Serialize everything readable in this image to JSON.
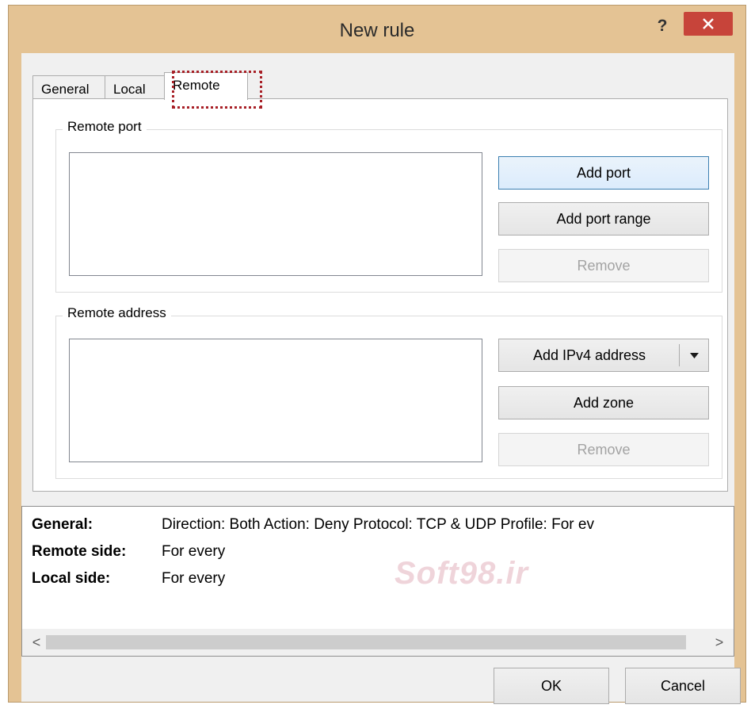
{
  "window": {
    "title": "New rule",
    "help_label": "?"
  },
  "tabs": [
    {
      "label": "General"
    },
    {
      "label": "Local"
    },
    {
      "label": "Remote"
    }
  ],
  "remote_port": {
    "group_label": "Remote port",
    "add_port": "Add port",
    "add_port_range": "Add port range",
    "remove": "Remove"
  },
  "remote_address": {
    "group_label": "Remote address",
    "add_ipv4": "Add IPv4 address",
    "add_zone": "Add zone",
    "remove": "Remove"
  },
  "summary": {
    "general_key": "General:",
    "general_val": "Direction: Both   Action: Deny   Protocol: TCP & UDP   Profile: For ev",
    "remote_key": "Remote side:",
    "remote_val": "For every",
    "local_key": "Local side:",
    "local_val": "For every",
    "watermark": "Soft98.ir"
  },
  "scrollbar": {
    "left_arrow": "<",
    "right_arrow": ">"
  },
  "buttons": {
    "ok": "OK",
    "cancel": "Cancel"
  },
  "colors": {
    "frame": "#e4c394",
    "close": "#c7443a",
    "focus_ring": "#a82027"
  }
}
